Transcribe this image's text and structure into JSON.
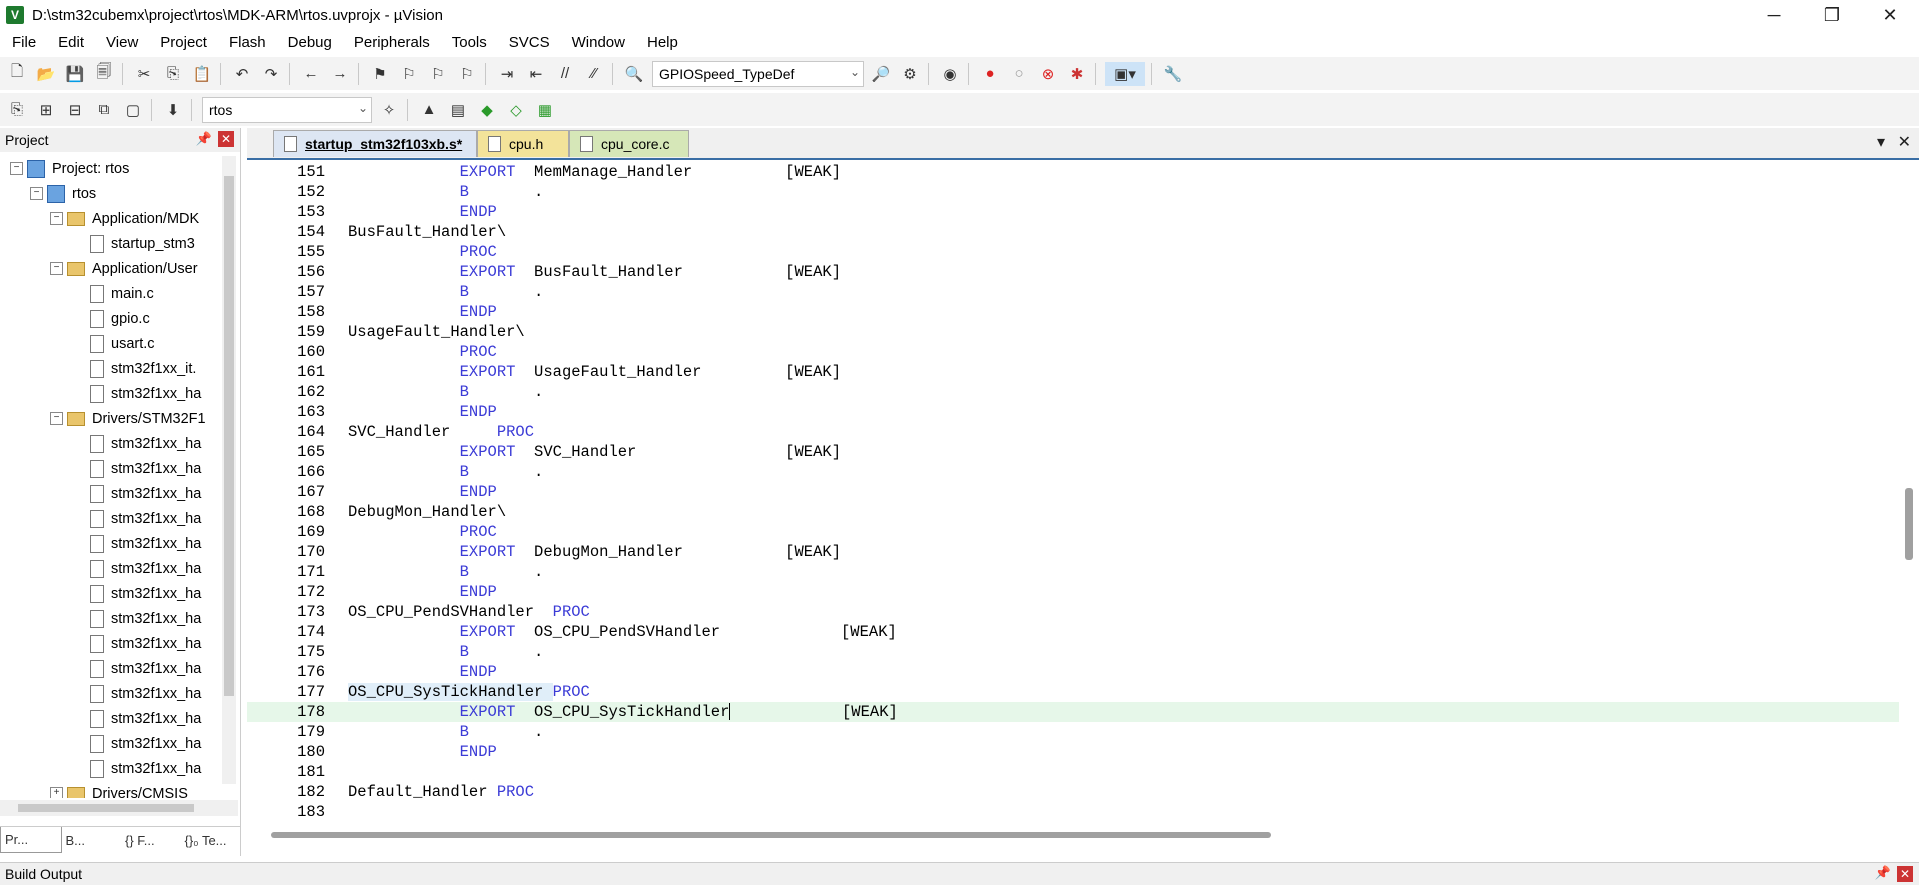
{
  "window": {
    "title": "D:\\stm32cubemx\\project\\rtos\\MDK-ARM\\rtos.uvprojx - µVision",
    "minimize": "─",
    "maximize": "❐",
    "close": "✕"
  },
  "menu": [
    "File",
    "Edit",
    "View",
    "Project",
    "Flash",
    "Debug",
    "Peripherals",
    "Tools",
    "SVCS",
    "Window",
    "Help"
  ],
  "toolbar1": {
    "find_combo_value": "GPIOSpeed_TypeDef"
  },
  "toolbar2": {
    "target_combo_value": "rtos"
  },
  "project_panel": {
    "title": "Project",
    "tree": [
      {
        "label": "Project: rtos",
        "level": 0,
        "kind": "project",
        "expand": "−"
      },
      {
        "label": "rtos",
        "level": 1,
        "kind": "target",
        "expand": "−"
      },
      {
        "label": "Application/MDK",
        "level": 2,
        "kind": "folder",
        "expand": "−"
      },
      {
        "label": "startup_stm3",
        "level": 3,
        "kind": "file",
        "expand": ""
      },
      {
        "label": "Application/User",
        "level": 2,
        "kind": "folder",
        "expand": "−"
      },
      {
        "label": "main.c",
        "level": 3,
        "kind": "file",
        "expand": ""
      },
      {
        "label": "gpio.c",
        "level": 3,
        "kind": "file",
        "expand": ""
      },
      {
        "label": "usart.c",
        "level": 3,
        "kind": "file",
        "expand": ""
      },
      {
        "label": "stm32f1xx_it.",
        "level": 3,
        "kind": "file",
        "expand": ""
      },
      {
        "label": "stm32f1xx_ha",
        "level": 3,
        "kind": "file",
        "expand": ""
      },
      {
        "label": "Drivers/STM32F1",
        "level": 2,
        "kind": "folder",
        "expand": "−"
      },
      {
        "label": "stm32f1xx_ha",
        "level": 3,
        "kind": "file",
        "expand": ""
      },
      {
        "label": "stm32f1xx_ha",
        "level": 3,
        "kind": "file",
        "expand": ""
      },
      {
        "label": "stm32f1xx_ha",
        "level": 3,
        "kind": "file",
        "expand": ""
      },
      {
        "label": "stm32f1xx_ha",
        "level": 3,
        "kind": "file",
        "expand": ""
      },
      {
        "label": "stm32f1xx_ha",
        "level": 3,
        "kind": "file",
        "expand": ""
      },
      {
        "label": "stm32f1xx_ha",
        "level": 3,
        "kind": "file",
        "expand": ""
      },
      {
        "label": "stm32f1xx_ha",
        "level": 3,
        "kind": "file",
        "expand": ""
      },
      {
        "label": "stm32f1xx_ha",
        "level": 3,
        "kind": "file",
        "expand": ""
      },
      {
        "label": "stm32f1xx_ha",
        "level": 3,
        "kind": "file",
        "expand": ""
      },
      {
        "label": "stm32f1xx_ha",
        "level": 3,
        "kind": "file",
        "expand": ""
      },
      {
        "label": "stm32f1xx_ha",
        "level": 3,
        "kind": "file",
        "expand": ""
      },
      {
        "label": "stm32f1xx_ha",
        "level": 3,
        "kind": "file",
        "expand": ""
      },
      {
        "label": "stm32f1xx_ha",
        "level": 3,
        "kind": "file",
        "expand": ""
      },
      {
        "label": "stm32f1xx_ha",
        "level": 3,
        "kind": "file",
        "expand": ""
      },
      {
        "label": "Drivers/CMSIS",
        "level": 2,
        "kind": "folder",
        "expand": "+"
      }
    ],
    "tabs": [
      "Pr...",
      "B...",
      "{} F...",
      "{}₀ Te..."
    ]
  },
  "editor": {
    "tabs": [
      {
        "label": "startup_stm32f103xb.s*",
        "active": true,
        "color": "#dde6f3"
      },
      {
        "label": "cpu.h",
        "active": false,
        "color": "#f3e39a"
      },
      {
        "label": "cpu_core.c",
        "active": false,
        "color": "#d6e7b8"
      }
    ],
    "lines": [
      {
        "n": "151",
        "pre": "",
        "kw": "",
        "mid": "            ",
        "kw2": "EXPORT",
        "post": "  MemManage_Handler          [WEAK]"
      },
      {
        "n": "152",
        "pre": "",
        "kw": "",
        "mid": "            ",
        "kw2": "B",
        "post": "       ."
      },
      {
        "n": "153",
        "pre": "",
        "kw": "",
        "mid": "            ",
        "kw2": "ENDP",
        "post": ""
      },
      {
        "n": "154",
        "pre": "BusFault_Handler\\",
        "kw": "",
        "mid": "",
        "kw2": "",
        "post": ""
      },
      {
        "n": "155",
        "pre": "",
        "kw": "",
        "mid": "            ",
        "kw2": "PROC",
        "post": ""
      },
      {
        "n": "156",
        "pre": "",
        "kw": "",
        "mid": "            ",
        "kw2": "EXPORT",
        "post": "  BusFault_Handler           [WEAK]"
      },
      {
        "n": "157",
        "pre": "",
        "kw": "",
        "mid": "            ",
        "kw2": "B",
        "post": "       ."
      },
      {
        "n": "158",
        "pre": "",
        "kw": "",
        "mid": "            ",
        "kw2": "ENDP",
        "post": ""
      },
      {
        "n": "159",
        "pre": "UsageFault_Handler\\",
        "kw": "",
        "mid": "",
        "kw2": "",
        "post": ""
      },
      {
        "n": "160",
        "pre": "",
        "kw": "",
        "mid": "            ",
        "kw2": "PROC",
        "post": ""
      },
      {
        "n": "161",
        "pre": "",
        "kw": "",
        "mid": "            ",
        "kw2": "EXPORT",
        "post": "  UsageFault_Handler         [WEAK]"
      },
      {
        "n": "162",
        "pre": "",
        "kw": "",
        "mid": "            ",
        "kw2": "B",
        "post": "       ."
      },
      {
        "n": "163",
        "pre": "",
        "kw": "",
        "mid": "            ",
        "kw2": "ENDP",
        "post": ""
      },
      {
        "n": "164",
        "pre": "SVC_Handler     ",
        "kw": "PROC",
        "mid": "",
        "kw2": "",
        "post": ""
      },
      {
        "n": "165",
        "pre": "",
        "kw": "",
        "mid": "            ",
        "kw2": "EXPORT",
        "post": "  SVC_Handler                [WEAK]"
      },
      {
        "n": "166",
        "pre": "",
        "kw": "",
        "mid": "            ",
        "kw2": "B",
        "post": "       ."
      },
      {
        "n": "167",
        "pre": "",
        "kw": "",
        "mid": "            ",
        "kw2": "ENDP",
        "post": ""
      },
      {
        "n": "168",
        "pre": "DebugMon_Handler\\",
        "kw": "",
        "mid": "",
        "kw2": "",
        "post": ""
      },
      {
        "n": "169",
        "pre": "",
        "kw": "",
        "mid": "            ",
        "kw2": "PROC",
        "post": ""
      },
      {
        "n": "170",
        "pre": "",
        "kw": "",
        "mid": "            ",
        "kw2": "EXPORT",
        "post": "  DebugMon_Handler           [WEAK]"
      },
      {
        "n": "171",
        "pre": "",
        "kw": "",
        "mid": "            ",
        "kw2": "B",
        "post": "       ."
      },
      {
        "n": "172",
        "pre": "",
        "kw": "",
        "mid": "            ",
        "kw2": "ENDP",
        "post": ""
      },
      {
        "n": "173",
        "pre": "OS_CPU_PendSVHandler  ",
        "kw": "PROC",
        "mid": "",
        "kw2": "",
        "post": ""
      },
      {
        "n": "174",
        "pre": "",
        "kw": "",
        "mid": "            ",
        "kw2": "EXPORT",
        "post": "  OS_CPU_PendSVHandler             [WEAK]"
      },
      {
        "n": "175",
        "pre": "",
        "kw": "",
        "mid": "            ",
        "kw2": "B",
        "post": "       ."
      },
      {
        "n": "176",
        "pre": "",
        "kw": "",
        "mid": "            ",
        "kw2": "ENDP",
        "post": ""
      },
      {
        "n": "177",
        "pre": "OS_CPU_SysTickHandler ",
        "kw": "PROC",
        "mid": "",
        "kw2": "",
        "post": "",
        "sel": true
      },
      {
        "n": "178",
        "pre": "",
        "kw": "",
        "mid": "            ",
        "kw2": "EXPORT",
        "post": "  OS_CPU_SysTickHandler",
        "post2": "            [WEAK]",
        "current": true
      },
      {
        "n": "179",
        "pre": "",
        "kw": "",
        "mid": "            ",
        "kw2": "B",
        "post": "       ."
      },
      {
        "n": "180",
        "pre": "",
        "kw": "",
        "mid": "            ",
        "kw2": "ENDP",
        "post": ""
      },
      {
        "n": "181",
        "pre": "",
        "kw": "",
        "mid": "",
        "kw2": "",
        "post": ""
      },
      {
        "n": "182",
        "pre": "Default_Handler ",
        "kw": "PROC",
        "mid": "",
        "kw2": "",
        "post": ""
      },
      {
        "n": "183",
        "pre": "",
        "kw": "",
        "mid": "",
        "kw2": "",
        "post": ""
      }
    ]
  },
  "build_output": {
    "title": "Build Output"
  }
}
